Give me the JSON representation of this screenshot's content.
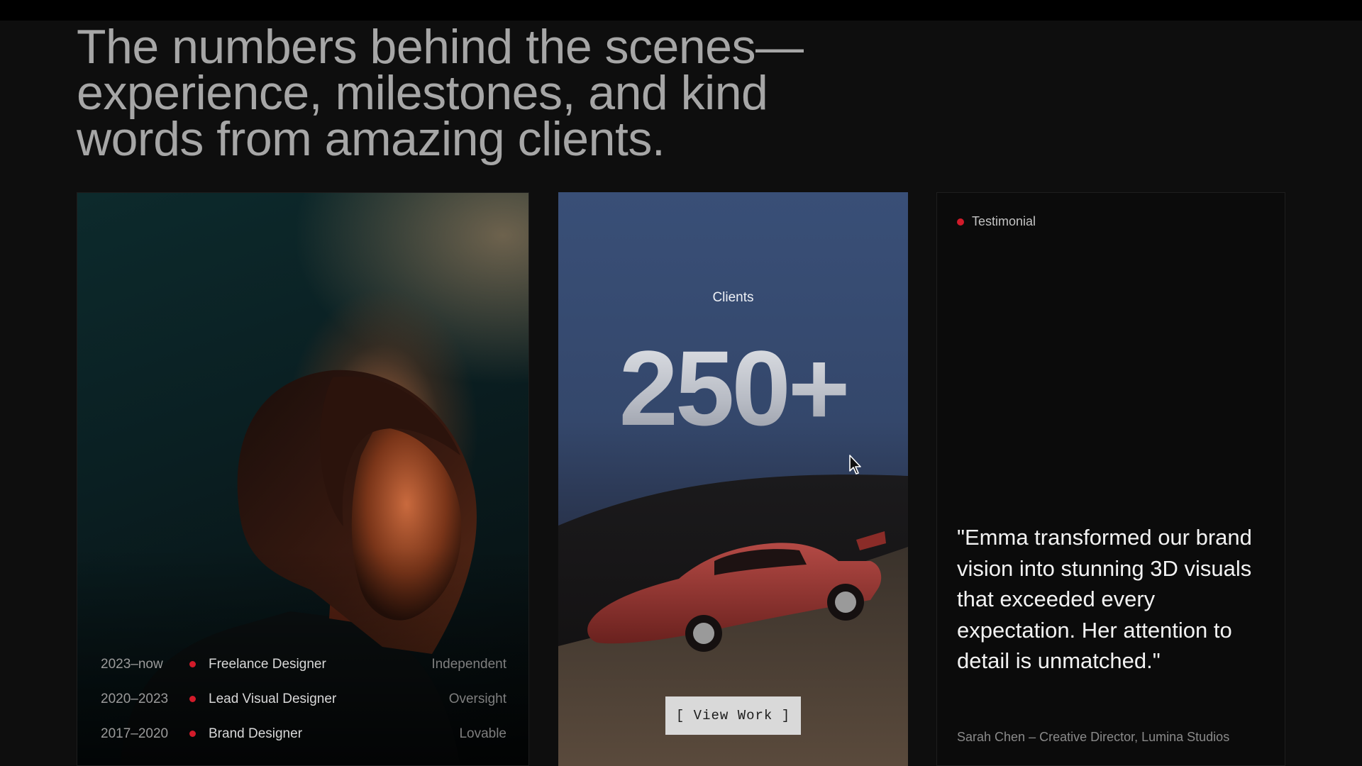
{
  "headline": {
    "line1": "The numbers behind the scenes—",
    "line2": "experience, milestones, and kind",
    "line3": "words from amazing clients."
  },
  "experience": [
    {
      "years": "2023–now",
      "role": "Freelance Designer",
      "company": "Independent"
    },
    {
      "years": "2020–2023",
      "role": "Lead Visual Designer",
      "company": "Oversight"
    },
    {
      "years": "2017–2020",
      "role": "Brand Designer",
      "company": "Lovable"
    }
  ],
  "clients": {
    "label": "Clients",
    "count": "250+",
    "button_label": "[ View Work ]"
  },
  "testimonial": {
    "tag": "Testimonial",
    "quote": "\"Emma transformed our brand vision into stunning 3D visuals that exceeded every expectation. Her attention to detail is unmatched.\"",
    "author": "Sarah Chen – Creative Director, Lumina Studios"
  },
  "colors": {
    "accent_red": "#d21b2a",
    "background": "#0e0e0e",
    "clients_sky": "#394f77"
  }
}
